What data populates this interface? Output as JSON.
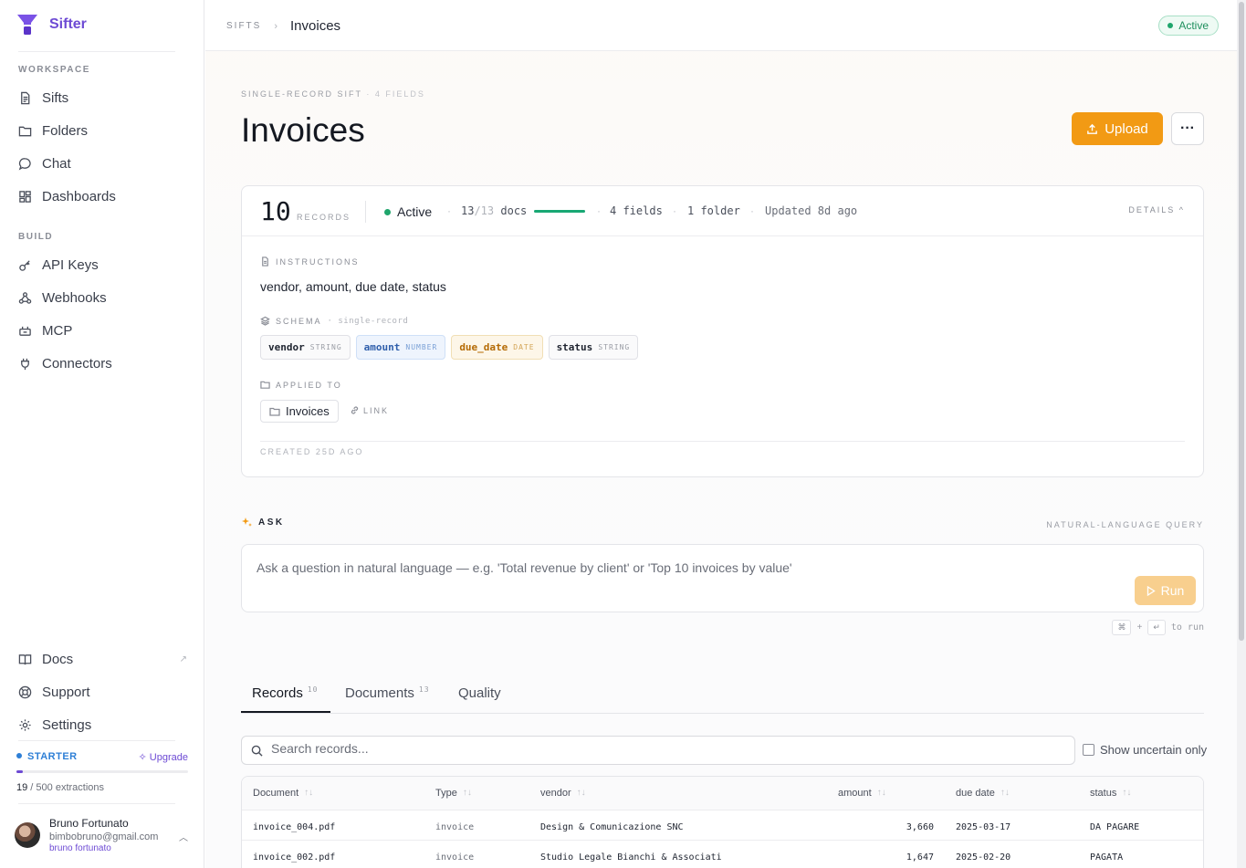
{
  "sidebar": {
    "brand": "Sifter",
    "workspace_label": "WORKSPACE",
    "workspace_items": [
      {
        "label": "Sifts",
        "icon": "document-icon"
      },
      {
        "label": "Folders",
        "icon": "folder-icon"
      },
      {
        "label": "Chat",
        "icon": "chat-icon"
      },
      {
        "label": "Dashboards",
        "icon": "grid-icon"
      }
    ],
    "build_label": "BUILD",
    "build_items": [
      {
        "label": "API Keys",
        "icon": "key-icon"
      },
      {
        "label": "Webhooks",
        "icon": "webhook-icon"
      },
      {
        "label": "MCP",
        "icon": "mcp-icon"
      },
      {
        "label": "Connectors",
        "icon": "plug-icon"
      }
    ],
    "bottom_items": [
      {
        "label": "Docs",
        "icon": "book-icon",
        "external": "↗"
      },
      {
        "label": "Support",
        "icon": "lifebuoy-icon"
      },
      {
        "label": "Settings",
        "icon": "gear-icon"
      }
    ],
    "plan": {
      "name": "STARTER",
      "upgrade": "Upgrade",
      "used": "19",
      "limit": " / 500 extractions",
      "usage_fraction": 0.038
    },
    "user": {
      "name": "Bruno Fortunato",
      "email": "bimbobruno@gmail.com",
      "username": "bruno fortunato"
    }
  },
  "topbar": {
    "crumb_root": "SIFTS",
    "crumb_sep": "›",
    "crumb_current": "Invoices",
    "status": "Active"
  },
  "header": {
    "kicker": "SINGLE-RECORD SIFT",
    "kicker_sep": "·",
    "kicker_fields": "4 FIELDS",
    "title": "Invoices",
    "upload_label": "Upload",
    "more_label": "···"
  },
  "stats": {
    "records": "10",
    "records_label": "RECORDS",
    "status": "Active",
    "docs_done": "13",
    "docs_total": "/13",
    "docs_label": " docs",
    "docs_fraction": 1.0,
    "fields": "4 fields",
    "folder": "1 folder",
    "updated": "Updated 8d ago",
    "details_label": "DETAILS ^",
    "sep": "·"
  },
  "details": {
    "instructions_label": "INSTRUCTIONS",
    "instructions": "vendor, amount, due date, status",
    "schema_label": "SCHEMA",
    "schema_sub": "· single-record",
    "schema": [
      {
        "name": "vendor",
        "type": "STRING"
      },
      {
        "name": "amount",
        "type": "NUMBER"
      },
      {
        "name": "due_date",
        "type": "DATE"
      },
      {
        "name": "status",
        "type": "STRING"
      }
    ],
    "applied_label": "APPLIED TO",
    "folder": "Invoices",
    "link_label": "LINK",
    "created": "CREATED 25D AGO"
  },
  "ask": {
    "label": "ASK",
    "mode": "NATURAL-LANGUAGE QUERY",
    "placeholder": "Ask a question in natural language — e.g. 'Total revenue by client' or 'Top 10 invoices by value'",
    "run_label": "Run",
    "hint_key1": "⌘",
    "hint_plus": "+",
    "hint_key2": "↵",
    "hint_text": "to run"
  },
  "tabs": [
    {
      "label": "Records",
      "count": "10"
    },
    {
      "label": "Documents",
      "count": "13"
    },
    {
      "label": "Quality",
      "count": ""
    }
  ],
  "records": {
    "search_placeholder": "Search records...",
    "uncertain_label": "Show uncertain only",
    "columns": [
      "Document",
      "Type",
      "vendor",
      "amount",
      "due date",
      "status"
    ],
    "sort_glyph": "↑↓",
    "rows": [
      [
        "invoice_004.pdf",
        "invoice",
        "Design & Comunicazione SNC",
        "3,660",
        "2025-03-17",
        "DA PAGARE"
      ],
      [
        "invoice_002.pdf",
        "invoice",
        "Studio Legale Bianchi & Associati",
        "1,647",
        "2025-02-20",
        "PAGATA"
      ]
    ]
  },
  "colors": {
    "accent": "#6d4ad4",
    "upload": "#f29a14",
    "success": "#1fa56c",
    "plan": "#2e7fd6"
  }
}
